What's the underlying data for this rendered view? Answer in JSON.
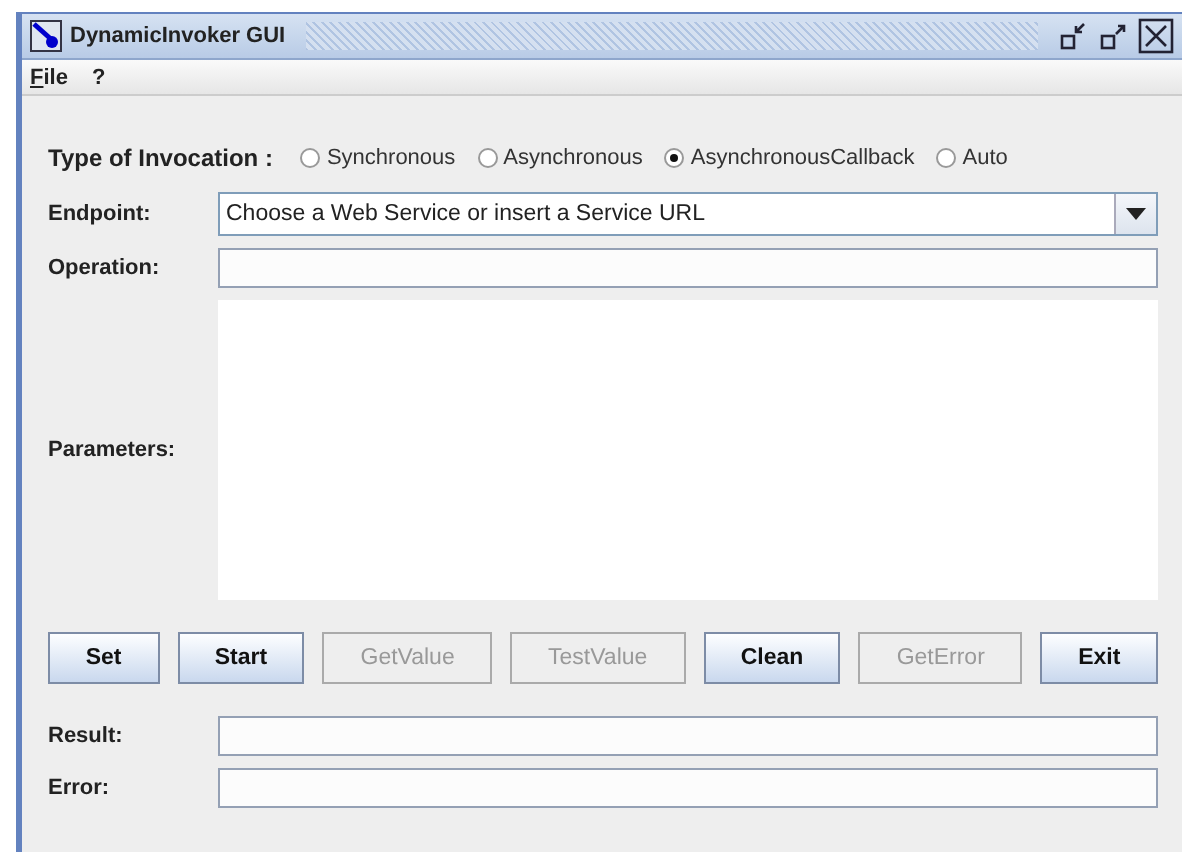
{
  "window": {
    "title": "DynamicInvoker GUI"
  },
  "menu": [
    {
      "label": "File",
      "mnemonic": true
    },
    {
      "label": "?",
      "mnemonic": false
    }
  ],
  "invocation": {
    "label": "Type of Invocation :",
    "options": [
      {
        "label": "Synchronous",
        "selected": false
      },
      {
        "label": "Asynchronous",
        "selected": false
      },
      {
        "label": "AsynchronousCallback",
        "selected": true
      },
      {
        "label": "Auto",
        "selected": false
      }
    ]
  },
  "endpoint": {
    "label": "Endpoint:",
    "value": "Choose a Web Service or insert a Service URL"
  },
  "operation": {
    "label": "Operation:"
  },
  "parameters": {
    "label": "Parameters:"
  },
  "buttons": [
    {
      "label": "Set",
      "disabled": false
    },
    {
      "label": "Start",
      "disabled": false
    },
    {
      "label": "GetValue",
      "disabled": true
    },
    {
      "label": "TestValue",
      "disabled": true
    },
    {
      "label": "Clean",
      "disabled": false
    },
    {
      "label": "GetError",
      "disabled": true
    },
    {
      "label": "Exit",
      "disabled": false
    }
  ],
  "result": {
    "label": "Result:"
  },
  "error": {
    "label": "Error:"
  }
}
